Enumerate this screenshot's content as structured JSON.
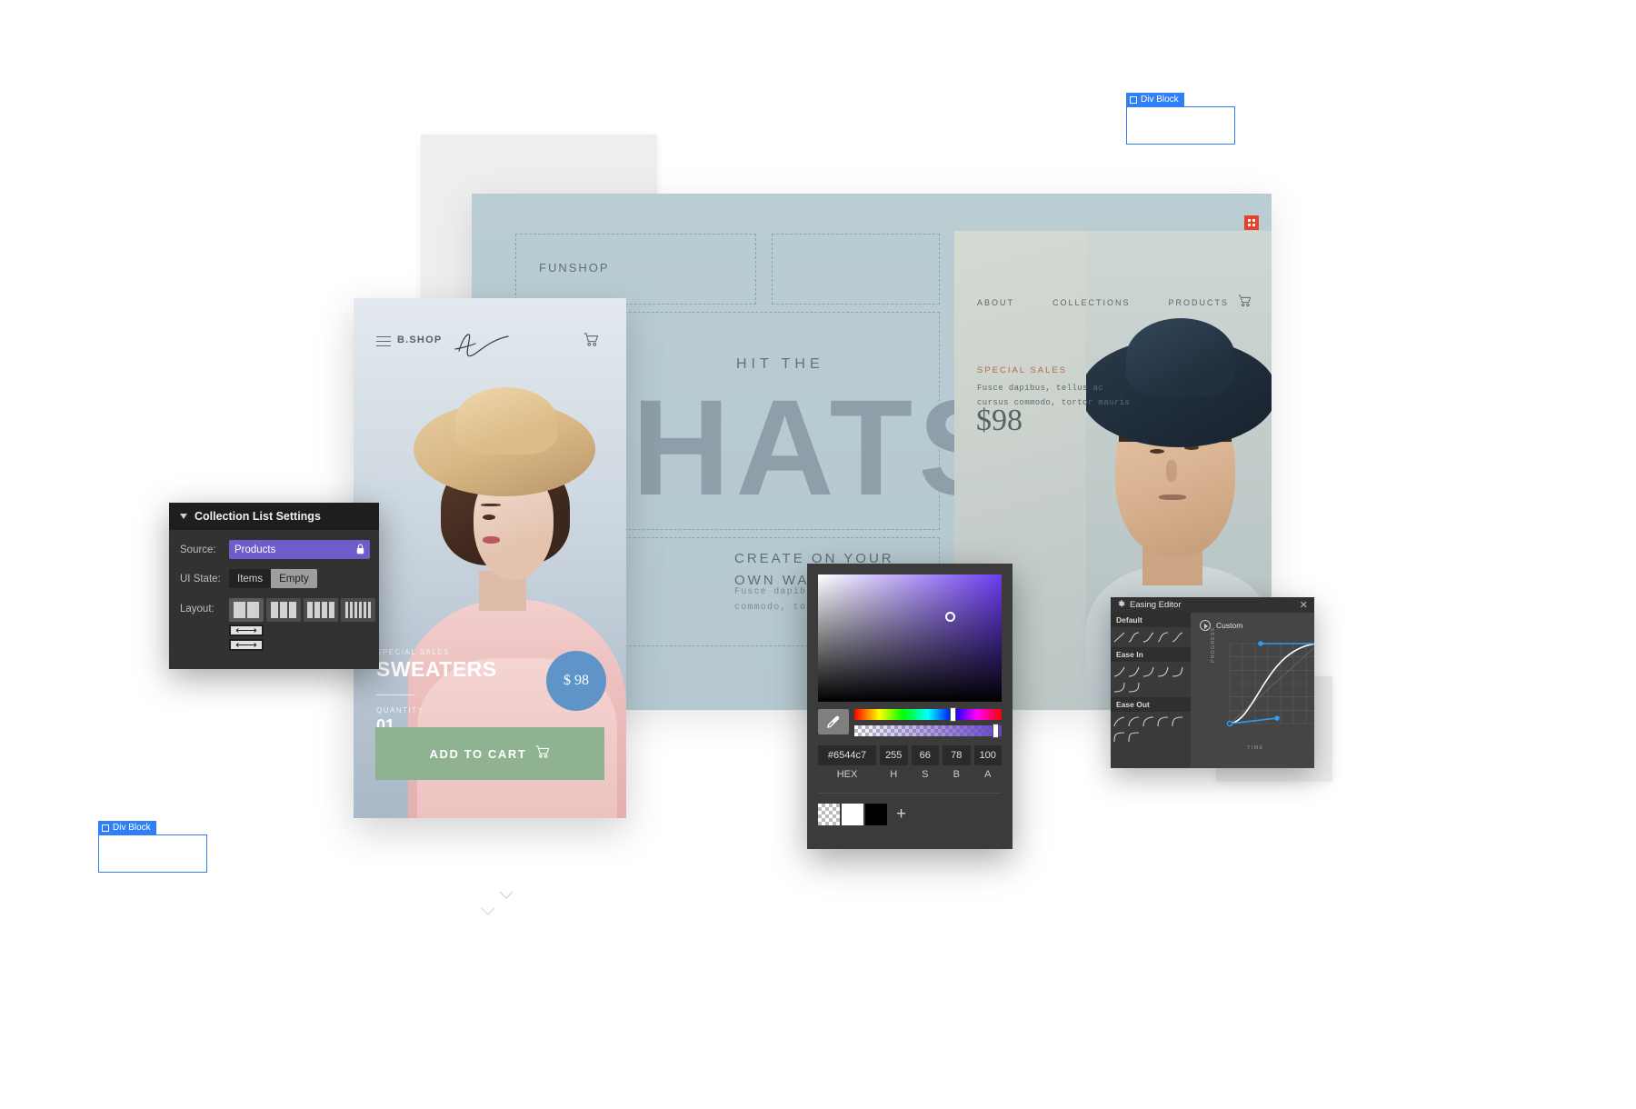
{
  "divblocks": [
    {
      "label": "Div Block",
      "icon": "checkbox-icon"
    },
    {
      "label": "Div Block",
      "icon": "checkbox-icon"
    }
  ],
  "desktop_mockup": {
    "brand": "FUNSHOP",
    "hero_kicker": "HIT THE",
    "hero_title": "HATS",
    "subhead_line1": "CREATE ON YOUR",
    "subhead_line2": "OWN WAY",
    "body_line1": "Fusce dapibus, tellus ac cursus",
    "body_line2": "commodo, tortor mauris",
    "nav": [
      "ABOUT",
      "COLLECTIONS",
      "PRODUCTS"
    ],
    "cart_icon": "shopping-cart-icon",
    "badge_icon": "webflow-badge-icon",
    "panel": {
      "eyebrow": "SPECIAL SALES",
      "desc_line1": "Fusce dapibus, tellus ac",
      "desc_line2": "cursus commodo, tortor mauris",
      "price": "$98"
    }
  },
  "mobile_mockup": {
    "brand": "B.SHOP",
    "menu_icon": "hamburger-menu-icon",
    "cart_icon": "shopping-cart-icon",
    "logo_icon": "signature-logo-icon",
    "eyebrow": "SPECIAL SALES",
    "title": "SWEATERS",
    "quantity_label": "QUANTITY",
    "quantity_value": "01",
    "price_badge": "$ 98",
    "cta_label": "ADD TO CART",
    "cta_icon": "shopping-cart-icon"
  },
  "collection_list_settings": {
    "title": "Collection List Settings",
    "collapse_icon": "triangle-down-icon",
    "source_label": "Source:",
    "source_value": "Products",
    "source_lock_icon": "lock-icon",
    "ui_state_label": "UI State:",
    "ui_state_options": [
      "Items",
      "Empty"
    ],
    "ui_state_selected": "Empty",
    "layout_label": "Layout:",
    "layout_options": [
      "2-column",
      "3-column",
      "4-column",
      "6-column"
    ],
    "layout_stack_options": [
      "stack-row-1",
      "stack-row-2"
    ],
    "accent_color": "#6e5ccb"
  },
  "color_picker": {
    "hex_value": "#6544c7",
    "hex_label": "HEX",
    "channels": [
      {
        "label": "H",
        "value": "255"
      },
      {
        "label": "S",
        "value": "66"
      },
      {
        "label": "B",
        "value": "78"
      },
      {
        "label": "A",
        "value": "100"
      }
    ],
    "eyedropper_icon": "eyedropper-icon",
    "add_swatch_icon": "plus-icon",
    "swatches": [
      "transparent",
      "#ffffff",
      "#000000"
    ],
    "selected_color": "#6544c7"
  },
  "easing_editor": {
    "title": "Easing Editor",
    "settings_icon": "gear-icon",
    "close_icon": "close-icon",
    "groups": [
      "Default",
      "Ease In",
      "Ease Out"
    ],
    "custom_label": "Custom",
    "play_icon": "play-circle-icon",
    "axis_y": "PROGRESS",
    "axis_x": "TIME",
    "handle_color": "#2f9bf5",
    "curve_points": {
      "p1": [
        0.3,
        0.02
      ],
      "p2": [
        0.7,
        0.98
      ]
    }
  }
}
